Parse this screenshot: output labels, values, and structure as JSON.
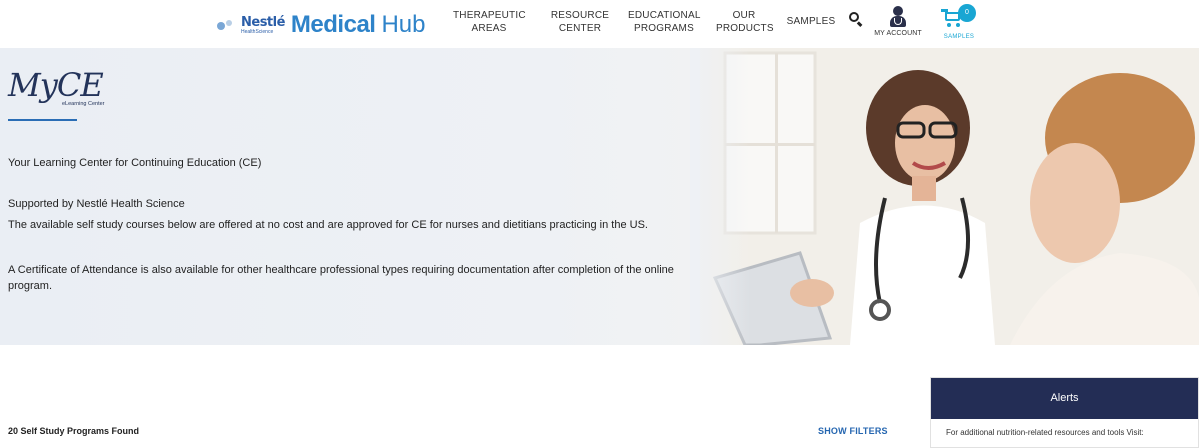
{
  "header": {
    "logo": {
      "brand": "Nestlé",
      "brand_sub": "HealthScience",
      "word1": "Medical",
      "word2": "Hub"
    },
    "nav": [
      {
        "label": "THERAPEUTIC AREAS"
      },
      {
        "label": "RESOURCE CENTER"
      },
      {
        "label": "EDUCATIONAL PROGRAMS"
      },
      {
        "label": "OUR PRODUCTS"
      },
      {
        "label": "SAMPLES"
      }
    ],
    "account_label": "MY ACCOUNT",
    "cart": {
      "count": "0",
      "label": "SAMPLES"
    }
  },
  "hero": {
    "logo": {
      "title": "MyCE",
      "subtitle": "eLearning Center"
    },
    "tagline": "Your Learning Center for Continuing Education (CE)",
    "supported": "Supported by Nestlé Health Science",
    "desc1": "The available self study courses below are offered at no cost and are approved for CE for nurses and dietitians practicing in the US.",
    "desc2": "A Certificate of Attendance is also available for other healthcare professional types requiring documentation after completion of the online program."
  },
  "results": {
    "count_text": "20 Self Study Programs Found",
    "show_filters": "SHOW FILTERS"
  },
  "alerts": {
    "title": "Alerts",
    "body": "For additional nutrition-related resources and tools Visit:"
  },
  "colors": {
    "brand_blue": "#2e83c9",
    "navy": "#232d55",
    "accent_cyan": "#19a6d3",
    "link_blue": "#2566b0"
  }
}
